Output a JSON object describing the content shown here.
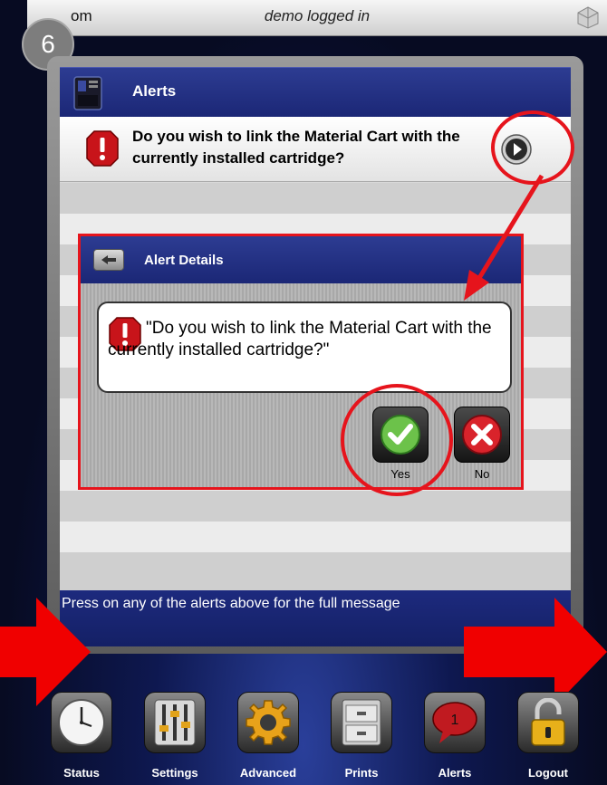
{
  "topbar": {
    "left_text": "om",
    "center_text": "demo logged in",
    "logo_icon": "3d-logo-icon"
  },
  "step": {
    "number": "6"
  },
  "panel": {
    "title": "Alerts",
    "printer_icon": "printer-icon",
    "alert_message": "Do you wish to link the Material Cart with the currently installed cartridge?",
    "footer_text": "Press on any of the alerts above for the full message"
  },
  "details": {
    "title": "Alert Details",
    "message": "\"Do you wish to link the Material Cart with the currently installed cartridge?\"",
    "yes_label": "Yes",
    "no_label": "No"
  },
  "toolbar": {
    "items": [
      {
        "label": "Status",
        "icon": "clock-icon"
      },
      {
        "label": "Settings",
        "icon": "sliders-icon"
      },
      {
        "label": "Advanced",
        "icon": "gear-icon"
      },
      {
        "label": "Prints",
        "icon": "file-cabinet-icon"
      },
      {
        "label": "Alerts",
        "icon": "speech-bubble-icon",
        "badge": "1"
      },
      {
        "label": "Logout",
        "icon": "padlock-icon"
      }
    ]
  },
  "colors": {
    "accent_red": "#e6141c",
    "header_blue": "#1b2776",
    "yes_green": "#6cc24a",
    "no_red": "#d9232b"
  }
}
